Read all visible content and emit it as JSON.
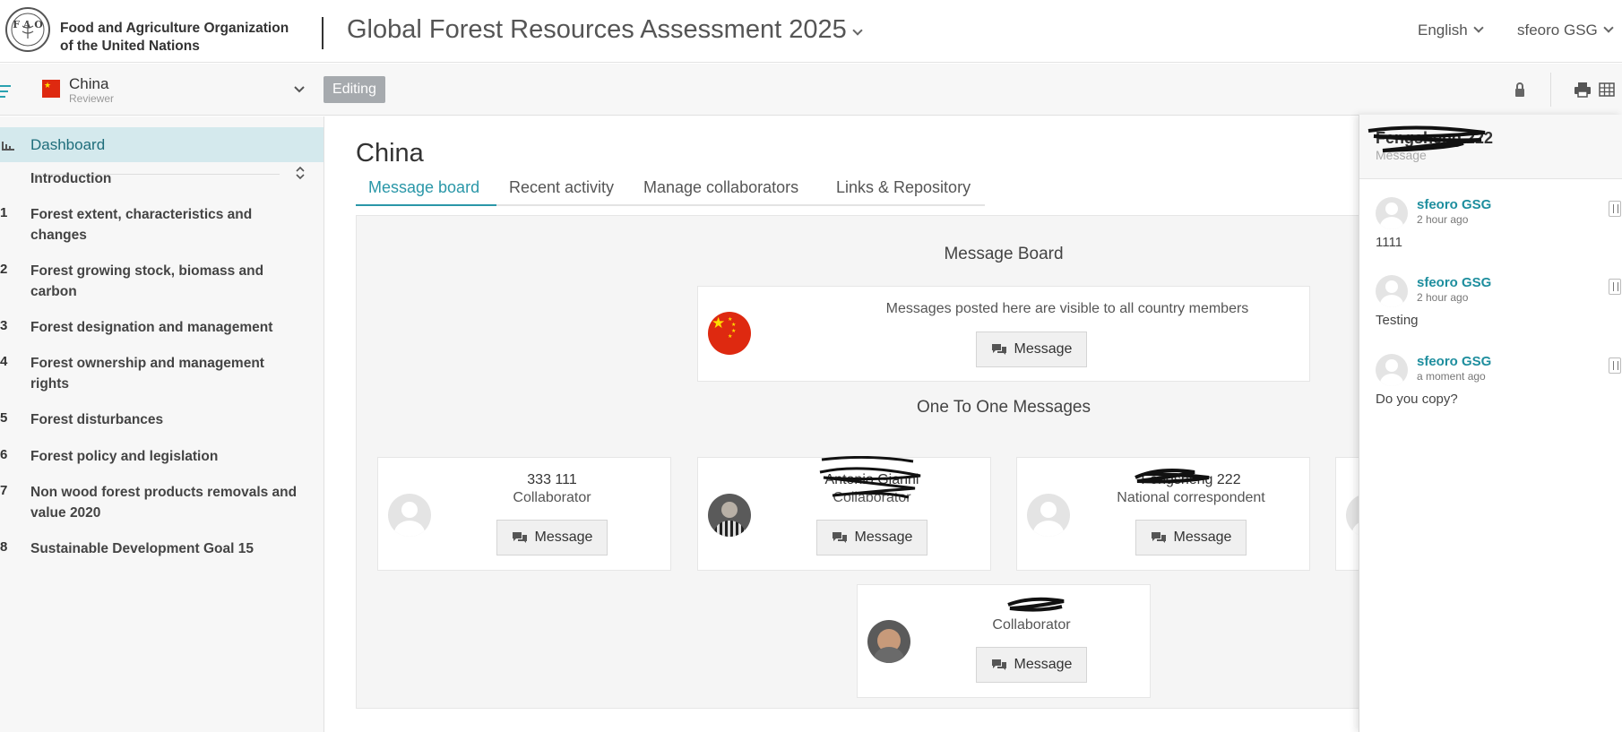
{
  "header": {
    "org_line1": "Food and Agriculture Organization",
    "org_line2": "of the United Nations",
    "app_title": "Global Forest Resources Assessment 2025",
    "language": "English",
    "user": "sfeoro GSG"
  },
  "subbar": {
    "country": "China",
    "role": "Reviewer",
    "editing_label": "Editing"
  },
  "sidebar": {
    "dashboard": "Dashboard",
    "items": [
      {
        "num": "",
        "label": "Introduction"
      },
      {
        "num": "1",
        "label": "Forest extent, characteristics and changes"
      },
      {
        "num": "2",
        "label": "Forest growing stock, biomass and carbon"
      },
      {
        "num": "3",
        "label": "Forest designation and management"
      },
      {
        "num": "4",
        "label": "Forest ownership and management rights"
      },
      {
        "num": "5",
        "label": "Forest disturbances"
      },
      {
        "num": "6",
        "label": "Forest policy and legislation"
      },
      {
        "num": "7",
        "label": "Non wood forest products removals and value 2020"
      },
      {
        "num": "8",
        "label": "Sustainable Development Goal 15"
      }
    ]
  },
  "main": {
    "title": "China",
    "tabs": [
      "Message board",
      "Recent activity",
      "Manage collaborators",
      "Links & Repository"
    ],
    "message_board_title": "Message Board",
    "message_board_text": "Messages posted here are visible to all country members",
    "message_label": "Message",
    "one_to_one_title": "One To One Messages",
    "collaborators": [
      {
        "name": "333 111",
        "role": "Collaborator"
      },
      {
        "name": "Antonio Gianni",
        "role": "Collaborator"
      },
      {
        "name": "Fengsheng 222",
        "role": "National correspondent"
      },
      {
        "name": "",
        "role": "Collaborator"
      }
    ]
  },
  "panel": {
    "title": "Fengsheng 222",
    "subtitle": "Message",
    "messages": [
      {
        "author": "sfeoro GSG",
        "time": "2 hour ago",
        "text": "1111"
      },
      {
        "author": "sfeoro GSG",
        "time": "2 hour ago",
        "text": "Testing"
      },
      {
        "author": "sfeoro GSG",
        "time": "a moment ago",
        "text": "Do you copy?"
      }
    ]
  },
  "colors": {
    "accent": "#2a97a8",
    "flag_red": "#de2910",
    "flag_yellow": "#ffde00"
  }
}
